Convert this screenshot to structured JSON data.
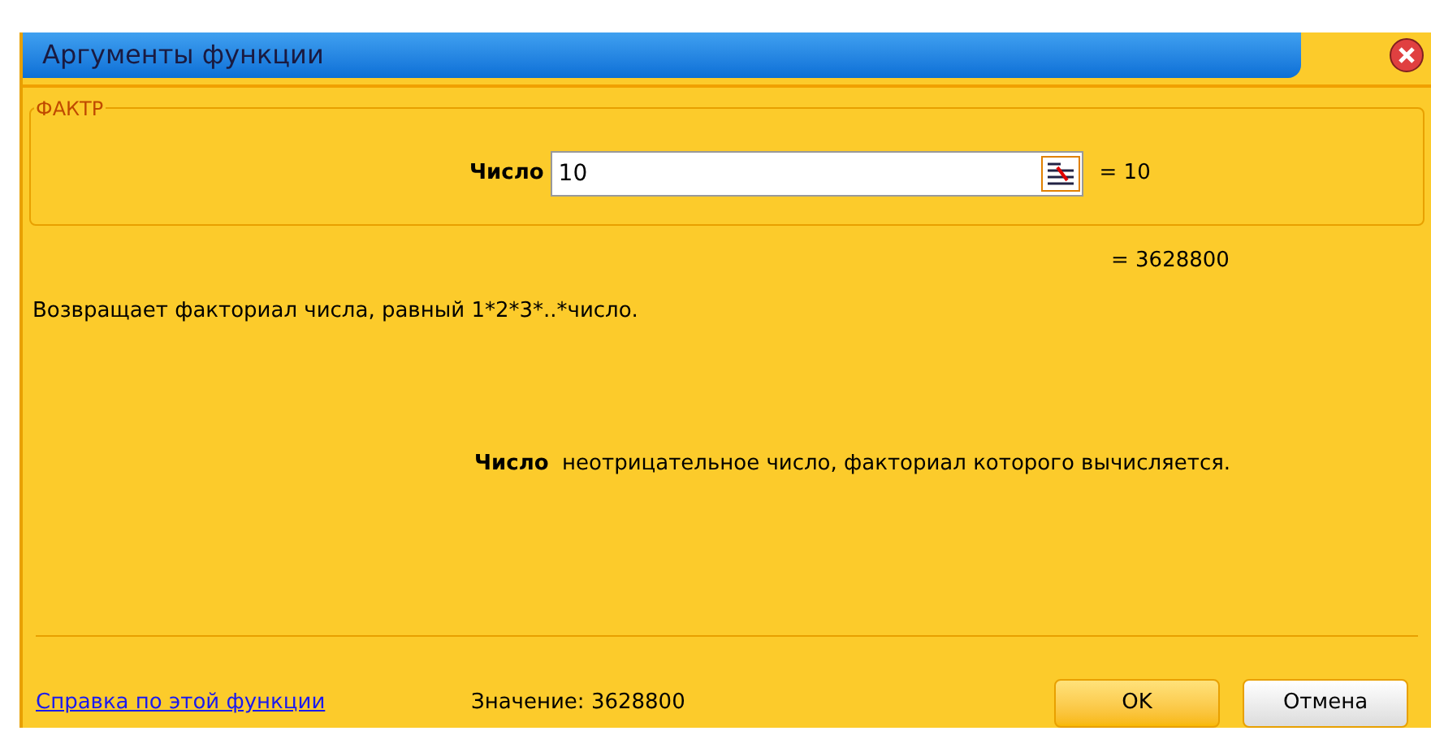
{
  "window": {
    "title": "Аргументы функции"
  },
  "function_group": {
    "name": "ФАКТР",
    "argument": {
      "label": "Число",
      "value": "10",
      "result": "= 10"
    }
  },
  "formula_result": "= 3628800",
  "description": "Возвращает факториал числа, равный 1*2*3*..*число.",
  "argument_help": {
    "name": "Число",
    "text": "неотрицательное число, факториал которого вычисляется."
  },
  "help_link": "Справка по этой функции",
  "value_label": "Значение:",
  "value": "3628800",
  "buttons": [
    {
      "label": "OK",
      "kind": "default"
    },
    {
      "label": "Отмена",
      "kind": "normal"
    }
  ]
}
